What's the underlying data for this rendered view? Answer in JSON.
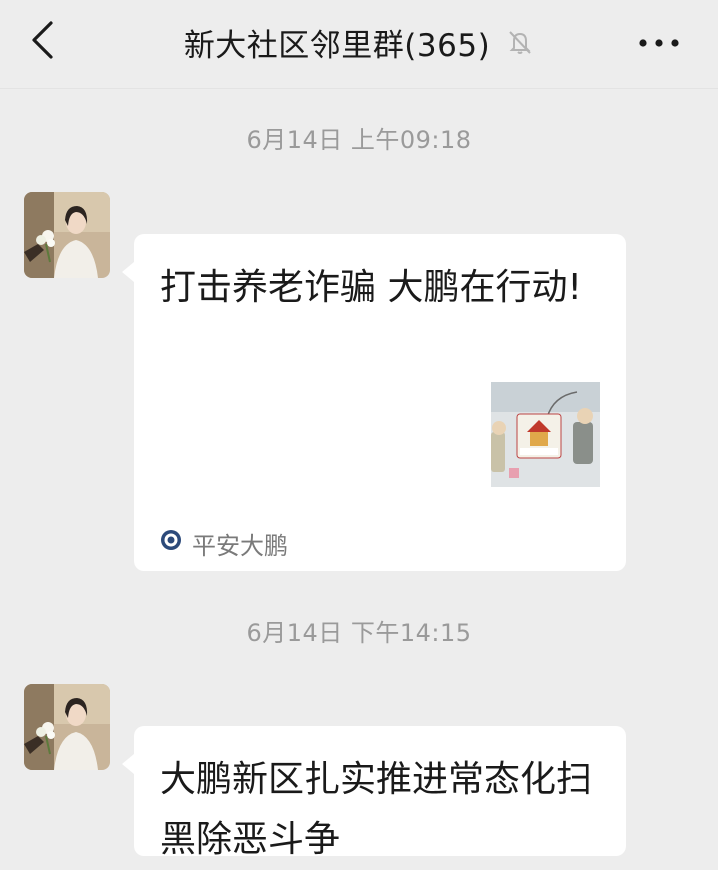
{
  "header": {
    "title": "新大社区邻里群(365)",
    "back_icon": "chevron-left-icon",
    "mute_icon": "bell-off-icon",
    "more_icon": "more-horizontal-icon"
  },
  "messages": [
    {
      "timestamp": "6月14日 上午09:18",
      "card_title": "打击养老诈骗 大鹏在行动!",
      "source_name": "平安大鹏",
      "source_icon": "police-badge-icon"
    },
    {
      "timestamp": "6月14日 下午14:15",
      "card_title": "大鹏新区扎实推进常态化扫黑除恶斗争"
    }
  ],
  "colors": {
    "background": "#ededed",
    "bubble": "#ffffff",
    "timestamp_text": "#9a9a9a",
    "title_text": "#1a1a1a"
  }
}
